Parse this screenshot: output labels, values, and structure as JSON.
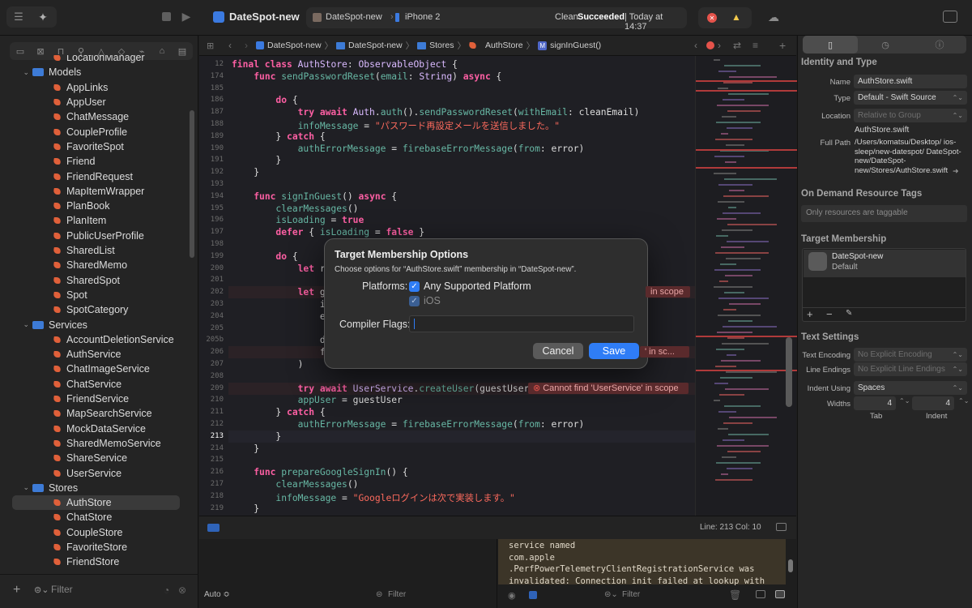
{
  "titlebar": {
    "project": "DateSpot-new",
    "scheme": "DateSpot-new",
    "destination": "iPhone 2",
    "status_prefix": "Clean",
    "status_state": "Succeeded",
    "status_time": "| Today at 14:37"
  },
  "jumpbar": {
    "crumbs": [
      "DateSpot-new",
      "DateSpot-new",
      "Stores",
      "AuthStore",
      "signInGuest()"
    ]
  },
  "sidebar": {
    "rows": [
      {
        "label": "LocationManager",
        "kind": "file",
        "indent": 2
      },
      {
        "label": "Models",
        "kind": "folder",
        "indent": 1
      },
      {
        "label": "AppLinks",
        "kind": "file",
        "indent": 2
      },
      {
        "label": "AppUser",
        "kind": "file",
        "indent": 2
      },
      {
        "label": "ChatMessage",
        "kind": "file",
        "indent": 2
      },
      {
        "label": "CoupleProfile",
        "kind": "file",
        "indent": 2
      },
      {
        "label": "FavoriteSpot",
        "kind": "file",
        "indent": 2
      },
      {
        "label": "Friend",
        "kind": "file",
        "indent": 2
      },
      {
        "label": "FriendRequest",
        "kind": "file",
        "indent": 2
      },
      {
        "label": "MapItemWrapper",
        "kind": "file",
        "indent": 2
      },
      {
        "label": "PlanBook",
        "kind": "file",
        "indent": 2
      },
      {
        "label": "PlanItem",
        "kind": "file",
        "indent": 2
      },
      {
        "label": "PublicUserProfile",
        "kind": "file",
        "indent": 2
      },
      {
        "label": "SharedList",
        "kind": "file",
        "indent": 2
      },
      {
        "label": "SharedMemo",
        "kind": "file",
        "indent": 2
      },
      {
        "label": "SharedSpot",
        "kind": "file",
        "indent": 2
      },
      {
        "label": "Spot",
        "kind": "file",
        "indent": 2
      },
      {
        "label": "SpotCategory",
        "kind": "file",
        "indent": 2
      },
      {
        "label": "Services",
        "kind": "folder",
        "indent": 1
      },
      {
        "label": "AccountDeletionService",
        "kind": "file",
        "indent": 2
      },
      {
        "label": "AuthService",
        "kind": "file",
        "indent": 2
      },
      {
        "label": "ChatImageService",
        "kind": "file",
        "indent": 2
      },
      {
        "label": "ChatService",
        "kind": "file",
        "indent": 2
      },
      {
        "label": "FriendService",
        "kind": "file",
        "indent": 2
      },
      {
        "label": "MapSearchService",
        "kind": "file",
        "indent": 2
      },
      {
        "label": "MockDataService",
        "kind": "file",
        "indent": 2
      },
      {
        "label": "SharedMemoService",
        "kind": "file",
        "indent": 2
      },
      {
        "label": "ShareService",
        "kind": "file",
        "indent": 2
      },
      {
        "label": "UserService",
        "kind": "file",
        "indent": 2
      },
      {
        "label": "Stores",
        "kind": "folder",
        "indent": 1
      },
      {
        "label": "AuthStore",
        "kind": "file",
        "indent": 2,
        "selected": true
      },
      {
        "label": "ChatStore",
        "kind": "file",
        "indent": 2
      },
      {
        "label": "CoupleStore",
        "kind": "file",
        "indent": 2
      },
      {
        "label": "FavoriteStore",
        "kind": "file",
        "indent": 2
      },
      {
        "label": "FriendStore",
        "kind": "file",
        "indent": 2
      }
    ],
    "filter_placeholder": "Filter"
  },
  "editor": {
    "lines": [
      {
        "n": "12",
        "html": "<span class=\"kw\">final class</span> <span class=\"ty\">AuthStore</span>: <span class=\"ty\">ObservableObject</span> {"
      },
      {
        "n": "174",
        "html": "    <span class=\"kw\">func</span> <span class=\"fn\">sendPasswordReset</span>(<span class=\"fn\">email</span>: <span class=\"ty\">String</span>) <span class=\"kw\">async</span> {"
      },
      {
        "n": "185",
        "html": ""
      },
      {
        "n": "186",
        "html": "        <span class=\"kw\">do</span> {"
      },
      {
        "n": "187",
        "html": "            <span class=\"kw\">try await</span> <span class=\"ty\">Auth</span>.<span class=\"fn\">auth</span>().<span class=\"fn\">sendPasswordReset</span>(<span class=\"fn\">withEmail</span>: cleanEmail)"
      },
      {
        "n": "188",
        "html": "            <span class=\"fn\">infoMessage</span> = <span class=\"str\">\"パスワード再設定メールを送信しました。\"</span>"
      },
      {
        "n": "189",
        "html": "        } <span class=\"kw\">catch</span> {"
      },
      {
        "n": "190",
        "html": "            <span class=\"fn\">authErrorMessage</span> = <span class=\"fn\">firebaseErrorMessage</span>(<span class=\"fn\">from</span>: error)"
      },
      {
        "n": "191",
        "html": "        }"
      },
      {
        "n": "192",
        "html": "    }"
      },
      {
        "n": "193",
        "html": ""
      },
      {
        "n": "194",
        "html": "    <span class=\"kw\">func</span> <span class=\"fn\">signInGuest</span>() <span class=\"kw\">async</span> {"
      },
      {
        "n": "195",
        "html": "        <span class=\"fn\">clearMessages</span>()"
      },
      {
        "n": "196",
        "html": "        <span class=\"fn\">isLoading</span> = <span class=\"kw\">true</span>"
      },
      {
        "n": "197",
        "html": "        <span class=\"kw\">defer</span> { <span class=\"fn\">isLoading</span> = <span class=\"kw\">false</span> }"
      },
      {
        "n": "198",
        "html": ""
      },
      {
        "n": "199",
        "html": "        <span class=\"kw\">do</span> {"
      },
      {
        "n": "200",
        "html": "            <span class=\"kw\">let</span> res"
      },
      {
        "n": "201",
        "html": ""
      },
      {
        "n": "202",
        "html": "            <span class=\"kw\">let</span> gue"
      },
      {
        "n": "203",
        "html": "                id"
      },
      {
        "n": "204",
        "html": "                ema"
      },
      {
        "n": "205",
        "html": ""
      },
      {
        "n": "205b",
        "html": "                dis"
      },
      {
        "n": "206",
        "html": "                fri"
      },
      {
        "n": "207",
        "html": "            )"
      },
      {
        "n": "208",
        "html": ""
      },
      {
        "n": "209",
        "html": "            <span class=\"kw\">try await</span> <span class=\"ty\">UserService</span>.<span class=\"fn\">createUser</span>(guestUser)"
      },
      {
        "n": "210",
        "html": "            <span class=\"fn\">appUser</span> = guestUser"
      },
      {
        "n": "211",
        "html": "        } <span class=\"kw\">catch</span> {"
      },
      {
        "n": "212",
        "html": "            <span class=\"fn\">authErrorMessage</span> = <span class=\"fn\">firebaseErrorMessage</span>(<span class=\"fn\">from</span>: error)"
      },
      {
        "n": "213",
        "html": "        }"
      },
      {
        "n": "214",
        "html": "    }"
      },
      {
        "n": "215",
        "html": ""
      },
      {
        "n": "216",
        "html": "    <span class=\"kw\">func</span> <span class=\"fn\">prepareGoogleSignIn</span>() {"
      },
      {
        "n": "217",
        "html": "        <span class=\"fn\">clearMessages</span>()"
      },
      {
        "n": "218",
        "html": "        <span class=\"fn\">infoMessage</span> = <span class=\"str\">\"Googleログインは次で実装します。\"</span>"
      },
      {
        "n": "219",
        "html": "    }"
      },
      {
        "n": "220",
        "html": ""
      },
      {
        "n": "221",
        "html": "    <span class=\"kw\">func</span> <span class=\"fn\">prepareAppleSignIn</span>() {"
      }
    ],
    "errors": [
      {
        "line_index": 19,
        "text": "in scope"
      },
      {
        "line_index": 24,
        "text": "' in sc..."
      },
      {
        "line_index": 27,
        "text": "Cannot find 'UserService' in scope"
      }
    ],
    "status": "Line: 213  Col: 10"
  },
  "console": {
    "text": "service named\ncom.apple\n.PerfPowerTelemetryClientRegistrationService was\ninvalidated: Connection init failed at lookup with",
    "auto_label": "Auto ≎",
    "filter_placeholder": "Filter"
  },
  "inspector": {
    "identity_header": "Identity and Type",
    "name_label": "Name",
    "name_value": "AuthStore.swift",
    "type_label": "Type",
    "type_value": "Default - Swift Source",
    "location_label": "Location",
    "location_value": "Relative to Group",
    "location_file": "AuthStore.swift",
    "fullpath_label": "Full Path",
    "fullpath_value": "/Users/komatsu/Desktop/ ios-sleep/new-datespot/ DateSpot-new/DateSpot- new/Stores/AuthStore.swift",
    "odr_header": "On Demand Resource Tags",
    "odr_placeholder": "Only resources are taggable",
    "tm_header": "Target Membership",
    "tm_target": "DateSpot-new",
    "tm_role": "Default",
    "text_header": "Text Settings",
    "enc_label": "Text Encoding",
    "enc_value": "No Explicit Encoding",
    "le_label": "Line Endings",
    "le_value": "No Explicit Line Endings",
    "indent_label": "Indent Using",
    "indent_value": "Spaces",
    "widths_label": "Widths",
    "tab_value": "4",
    "indent_width_value": "4",
    "tab_caption": "Tab",
    "indent_caption": "Indent"
  },
  "dialog": {
    "title": "Target Membership Options",
    "subtitle": "Choose options for “AuthStore.swift” membership in “DateSpot-new”.",
    "platforms_label": "Platforms:",
    "platform_any": "Any Supported Platform",
    "platform_ios": "iOS",
    "flags_label": "Compiler Flags:",
    "flags_value": "",
    "cancel": "Cancel",
    "save": "Save"
  },
  "colors": {
    "accent": "#2f7df6",
    "error": "#e5534b",
    "warning": "#f2c94c"
  }
}
